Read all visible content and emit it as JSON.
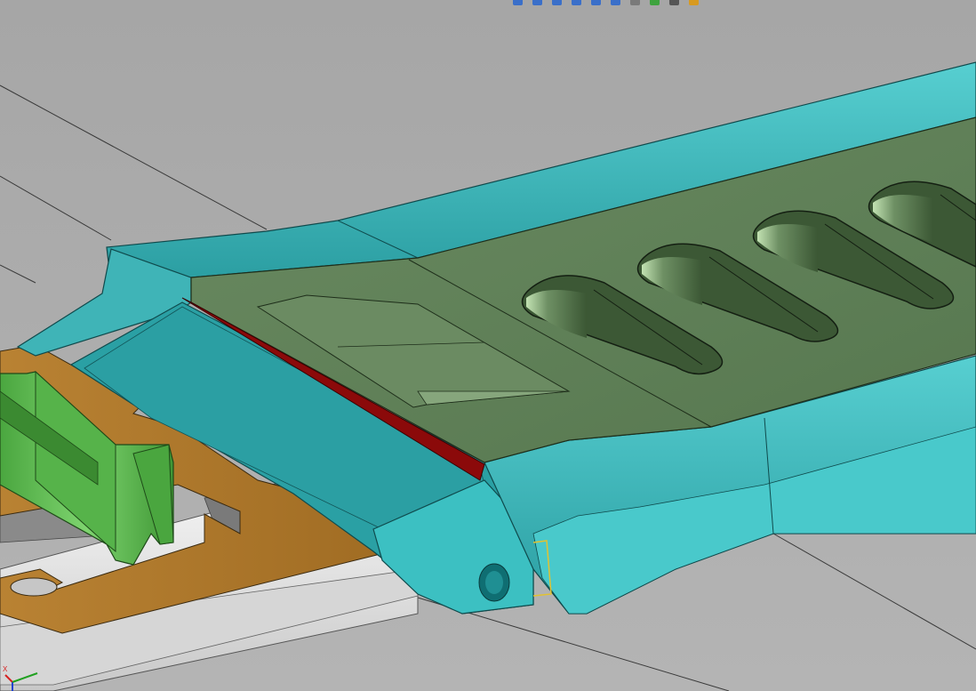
{
  "window": {
    "title": ""
  },
  "viewport": {
    "background_color": "#a9a9a9",
    "part_colors": {
      "frame": "#3cb5b8",
      "frame_light": "#5fd0d0",
      "frame_dark": "#218f93",
      "top_plate": "#5f7f57",
      "top_plate_dark": "#4b6b44",
      "slot_interior": "#3e5a37",
      "slot_highlight": "#b8d8a8",
      "seal_strip": "#8b0a0a",
      "connector": "#5ab84e",
      "connector_dark": "#3a8a30",
      "pcb": "#b07a2c",
      "base_plate": "#e0e0e0"
    }
  },
  "toolbar": {
    "icons": [
      {
        "name": "zoom-to-fit-icon",
        "color": "#3a6fc9"
      },
      {
        "name": "zoom-to-area-icon",
        "color": "#3a6fc9"
      },
      {
        "name": "previous-view-icon",
        "color": "#3a6fc9"
      },
      {
        "name": "section-view-icon",
        "color": "#3a6fc9"
      },
      {
        "name": "view-orientation-icon",
        "color": "#3a6fc9"
      },
      {
        "name": "display-style-icon",
        "color": "#3a6fc9"
      },
      {
        "name": "hide-show-items-icon",
        "color": "#7a7a7a"
      },
      {
        "name": "edit-appearance-icon",
        "color": "#3ea33e"
      },
      {
        "name": "apply-scene-icon",
        "color": "#555555"
      },
      {
        "name": "view-settings-icon",
        "color": "#d89a20"
      }
    ]
  },
  "triad": {
    "x_label": "X",
    "y_label": "Y",
    "z_label": "Z",
    "x_color": "#d62020",
    "y_color": "#20a020",
    "z_color": "#2040d0"
  }
}
